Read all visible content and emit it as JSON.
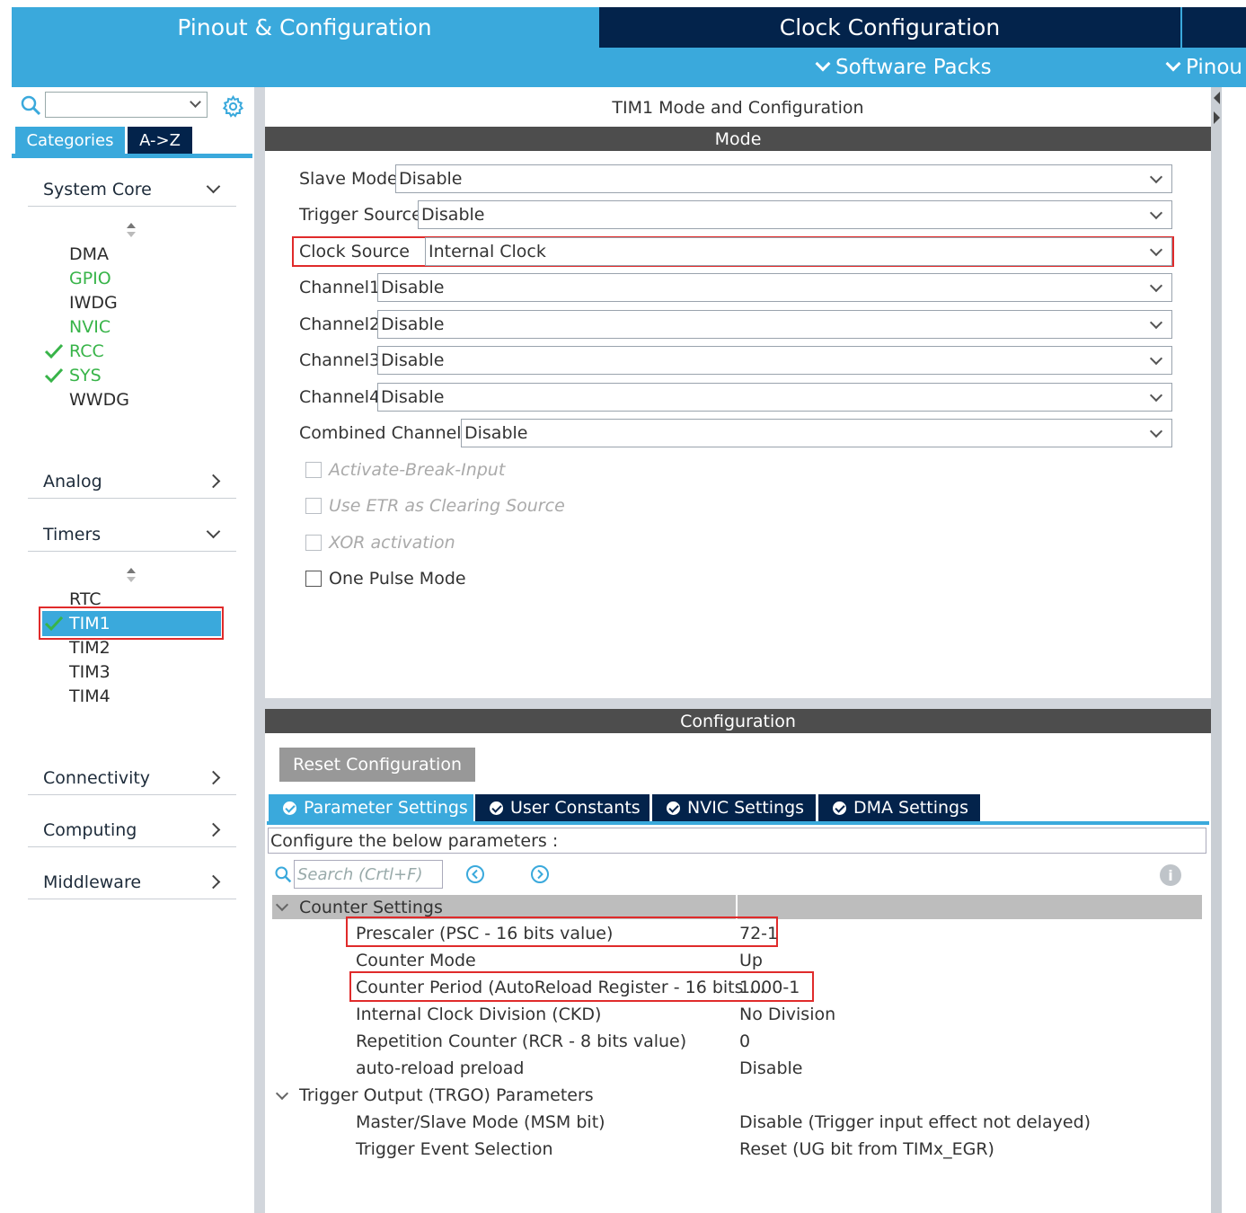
{
  "header": {
    "tab_pinout": "Pinout & Configuration",
    "tab_clock": "Clock Configuration",
    "menu_software_packs": "Software Packs",
    "menu_pinout": "Pinou"
  },
  "sidebar": {
    "tab_categories": "Categories",
    "tab_az": "A->Z",
    "group_system_core": "System Core",
    "system_core_items": [
      "DMA",
      "GPIO",
      "IWDG",
      "NVIC",
      "RCC",
      "SYS",
      "WWDG"
    ],
    "group_analog": "Analog",
    "group_timers": "Timers",
    "timer_items": [
      "RTC",
      "TIM1",
      "TIM2",
      "TIM3",
      "TIM4"
    ],
    "group_connectivity": "Connectivity",
    "group_computing": "Computing",
    "group_middleware": "Middleware"
  },
  "panel": {
    "title": "TIM1 Mode and Configuration",
    "mode_header": "Mode",
    "config_header": "Configuration"
  },
  "mode": {
    "slave_mode_label": "Slave Mode",
    "slave_mode_value": "Disable",
    "trigger_source_label": "Trigger Source",
    "trigger_source_value": "Disable",
    "clock_source_label": "Clock Source",
    "clock_source_value": "Internal Clock",
    "channel1_label": "Channel1",
    "channel1_value": "Disable",
    "channel2_label": "Channel2",
    "channel2_value": "Disable",
    "channel3_label": "Channel3",
    "channel3_value": "Disable",
    "channel4_label": "Channel4",
    "channel4_value": "Disable",
    "combined_label": "Combined Channels",
    "combined_value": "Disable",
    "cb_break": "Activate-Break-Input",
    "cb_etr": "Use ETR as Clearing Source",
    "cb_xor": "XOR activation",
    "cb_onepulse": "One Pulse Mode"
  },
  "config": {
    "reset_button": "Reset Configuration",
    "tab_param": "Parameter Settings",
    "tab_user": "User Constants",
    "tab_nvic": "NVIC Settings",
    "tab_dma": "DMA Settings",
    "description": "Configure the below parameters :",
    "search_placeholder": "Search (Crtl+F)",
    "counter_settings": "Counter Settings",
    "trgo_params": "Trigger Output (TRGO) Parameters",
    "rows": [
      {
        "label": "Prescaler (PSC - 16 bits value)",
        "value": "72-1"
      },
      {
        "label": "Counter Mode",
        "value": "Up"
      },
      {
        "label": "Counter Period (AutoReload Register - 16 bits ...",
        "value": "1000-1"
      },
      {
        "label": "Internal Clock Division (CKD)",
        "value": "No Division"
      },
      {
        "label": "Repetition Counter (RCR - 8 bits value)",
        "value": "0"
      },
      {
        "label": "auto-reload preload",
        "value": "Disable"
      }
    ],
    "trgo_rows": [
      {
        "label": "Master/Slave Mode (MSM bit)",
        "value": "Disable (Trigger input effect not delayed)"
      },
      {
        "label": "Trigger Event Selection",
        "value": "Reset (UG bit from TIMx_EGR)"
      }
    ]
  },
  "colors": {
    "accent": "#3aa9dc",
    "navy": "#03234b",
    "section_bar": "#4d4d4d",
    "enabled_green": "#38b449",
    "highlight_red": "#e02b2b"
  }
}
